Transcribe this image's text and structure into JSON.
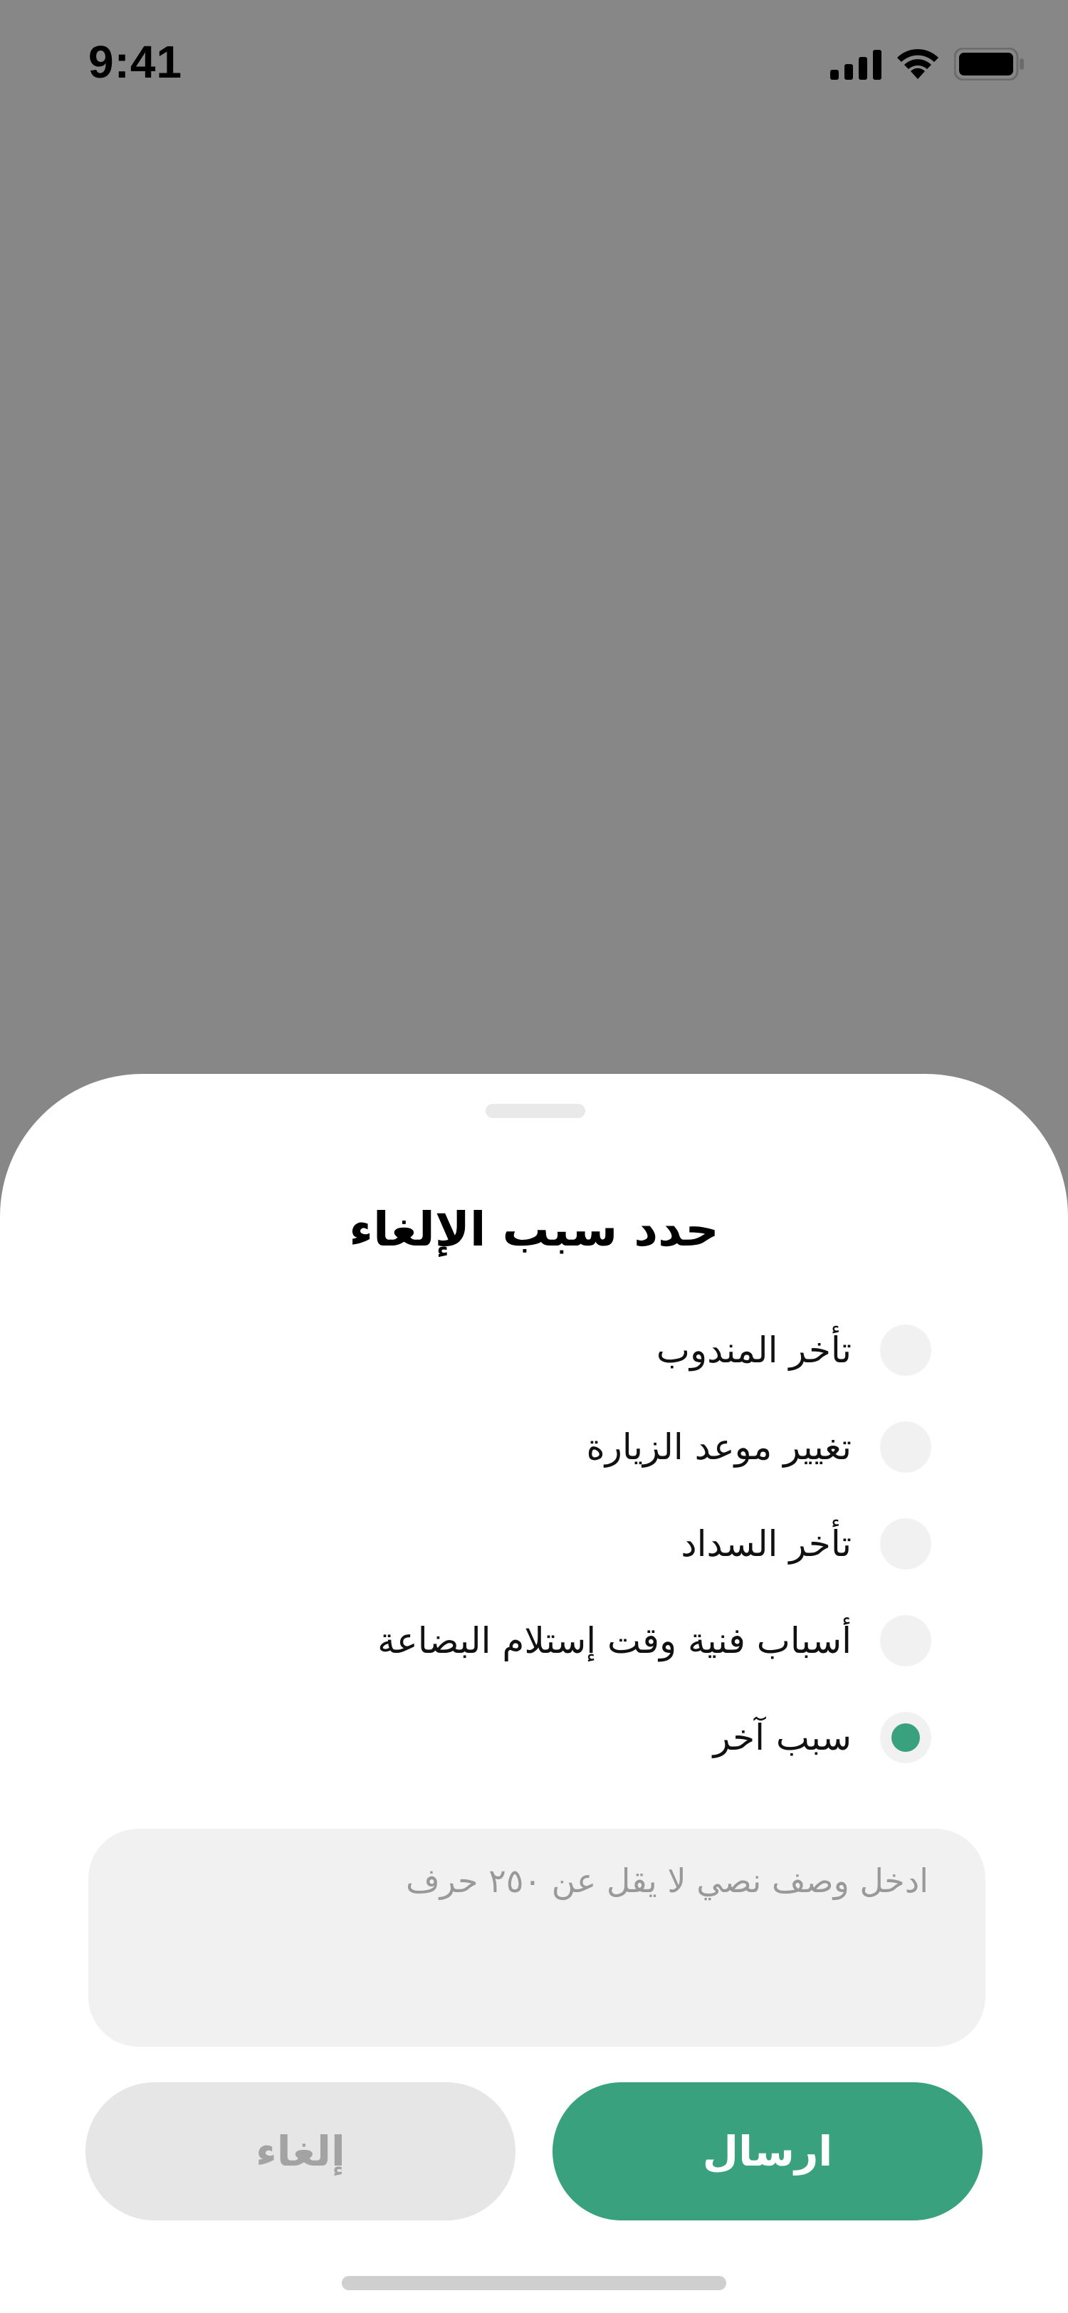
{
  "status_bar": {
    "time": "9:41"
  },
  "sheet": {
    "title": "حدد سبب الإلغاء",
    "options": [
      {
        "label": "تأخر المندوب",
        "selected": false
      },
      {
        "label": "تغيير موعد الزيارة",
        "selected": false
      },
      {
        "label": "تأخر السداد",
        "selected": false
      },
      {
        "label": "أسباب فنية وقت إستلام البضاعة",
        "selected": false
      },
      {
        "label": "سبب آخر",
        "selected": true
      }
    ],
    "description_placeholder": "ادخل وصف نصي لا يقل عن ٢٥٠ حرف",
    "send_label": "ارسال",
    "cancel_label": "إلغاء"
  },
  "colors": {
    "accent": "#3aa17e",
    "overlay": "#878787",
    "field_bg": "#f1f1f1"
  },
  "icons": [
    "signal-icon",
    "wifi-icon",
    "battery-icon"
  ]
}
